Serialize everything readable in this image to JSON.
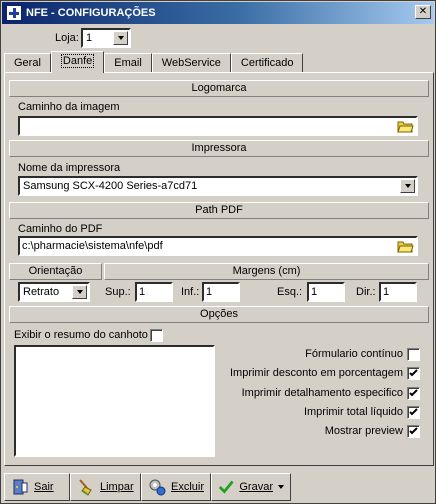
{
  "window": {
    "title": "NFE - CONFIGURAÇÕES",
    "close_glyph": "✕"
  },
  "loja": {
    "label": "Loja:",
    "value": "1"
  },
  "tabs": [
    {
      "label": "Geral"
    },
    {
      "label": "Danfe"
    },
    {
      "label": "Email"
    },
    {
      "label": "WebService"
    },
    {
      "label": "Certificado"
    }
  ],
  "logomarca": {
    "header": "Logomarca",
    "path_label": "Caminho da imagem",
    "path_value": ""
  },
  "impressora": {
    "header": "Impressora",
    "name_label": "Nome da impressora",
    "name_value": "Samsung SCX-4200 Series-a7cd71"
  },
  "pdf": {
    "header": "Path PDF",
    "path_label": "Caminho do PDF",
    "path_value": "c:\\pharmacie\\sistema\\nfe\\pdf"
  },
  "orientacao": {
    "header": "Orientação",
    "value": "Retrato"
  },
  "margens": {
    "header": "Margens (cm)",
    "sup_label": "Sup.:",
    "sup": "1",
    "inf_label": "Inf.:",
    "inf": "1",
    "esq_label": "Esq.:",
    "esq": "1",
    "dir_label": "Dir.:",
    "dir": "1"
  },
  "opcoes": {
    "header": "Opções",
    "resumo_label": "Exibir o resumo do canhoto",
    "resumo_checked": false,
    "formulario_label": "Fórmulario contínuo",
    "formulario_checked": false,
    "desconto_label": "Imprimir desconto em porcentagem",
    "desconto_checked": true,
    "detalhamento_label": "Imprimir detalhamento especifico",
    "detalhamento_checked": true,
    "total_label": "Imprimir total líquido",
    "total_checked": true,
    "preview_label": "Mostrar preview",
    "preview_checked": true
  },
  "buttons": {
    "sair": "Sair",
    "limpar": "Limpar",
    "excluir": "Excluir",
    "gravar": "Gravar"
  }
}
